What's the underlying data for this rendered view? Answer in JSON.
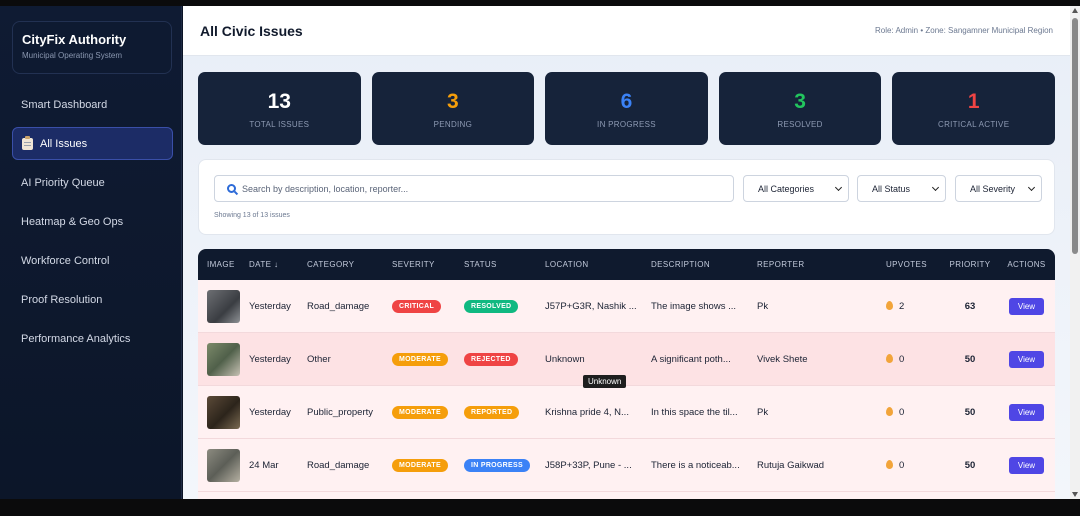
{
  "brand": {
    "title": "CityFix Authority",
    "subtitle": "Municipal Operating System"
  },
  "nav": [
    {
      "label": "Smart Dashboard"
    },
    {
      "label": "All Issues",
      "icon": "clipboard-icon",
      "active": true
    },
    {
      "label": "AI Priority Queue"
    },
    {
      "label": "Heatmap & Geo Ops"
    },
    {
      "label": "Workforce Control"
    },
    {
      "label": "Proof Resolution"
    },
    {
      "label": "Performance Analytics"
    }
  ],
  "header": {
    "title": "All Civic Issues",
    "role": "Role: Admin • Zone: Sangamner Municipal Region"
  },
  "stats": [
    {
      "value": "13",
      "label": "TOTAL ISSUES",
      "color": "#ffffff"
    },
    {
      "value": "3",
      "label": "PENDING",
      "color": "#f59e0b"
    },
    {
      "value": "6",
      "label": "IN PROGRESS",
      "color": "#3b82f6"
    },
    {
      "value": "3",
      "label": "RESOLVED",
      "color": "#22c55e"
    },
    {
      "value": "1",
      "label": "CRITICAL ACTIVE",
      "color": "#ef4444"
    }
  ],
  "filters": {
    "search_placeholder": "Search by description, location, reporter...",
    "category": "All Categories",
    "status": "All Status",
    "severity": "All Severity",
    "showing": "Showing 13 of 13 issues"
  },
  "table": {
    "headers": {
      "image": "IMAGE",
      "date": "DATE ↓",
      "category": "CATEGORY",
      "severity": "SEVERITY",
      "status": "STATUS",
      "location": "LOCATION",
      "description": "DESCRIPTION",
      "reporter": "REPORTER",
      "upvotes": "UPVOTES",
      "priority": "PRIORITY",
      "actions": "ACTIONS"
    },
    "rows": [
      {
        "date": "Yesterday",
        "category": "Road_damage",
        "severity": "CRITICAL",
        "severity_color": "#ef4444",
        "status": "RESOLVED",
        "status_color": "#10b981",
        "location": "J57P+G3R, Nashik ...",
        "description": "The image shows ...",
        "reporter": "Pk",
        "upvotes": "2",
        "priority": "63",
        "action": "View"
      },
      {
        "date": "Yesterday",
        "category": "Other",
        "severity": "MODERATE",
        "severity_color": "#f59e0b",
        "status": "REJECTED",
        "status_color": "#ef4444",
        "location": "Unknown",
        "description": "A significant poth...",
        "reporter": "Vivek Shete",
        "upvotes": "0",
        "priority": "50",
        "action": "View"
      },
      {
        "date": "Yesterday",
        "category": "Public_property",
        "severity": "MODERATE",
        "severity_color": "#f59e0b",
        "status": "REPORTED",
        "status_color": "#f59e0b",
        "location": "Krishna pride 4, N...",
        "description": "In this space the til...",
        "reporter": "Pk",
        "upvotes": "0",
        "priority": "50",
        "action": "View"
      },
      {
        "date": "24 Mar",
        "category": "Road_damage",
        "severity": "MODERATE",
        "severity_color": "#f59e0b",
        "status": "IN PROGRESS",
        "status_color": "#3b82f6",
        "location": "J58P+33P, Pune - ...",
        "description": "There is a noticeab...",
        "reporter": "Rutuja Gaikwad",
        "upvotes": "0",
        "priority": "50",
        "action": "View"
      }
    ]
  },
  "tooltip": "Unknown"
}
